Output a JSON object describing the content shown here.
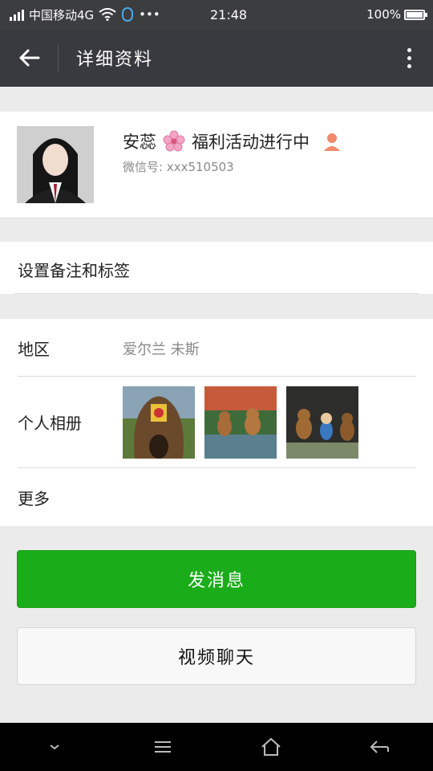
{
  "status_bar": {
    "carrier": "中国移动4G",
    "time": "21:48",
    "battery": "100%"
  },
  "app_bar": {
    "title": "详细资料"
  },
  "profile": {
    "name": "安蕊",
    "name_suffix": "福利活动进行中",
    "wechat_id": "微信号: xxx510503"
  },
  "remark": {
    "label": "设置备注和标签"
  },
  "info": {
    "region_label": "地区",
    "region_value": "爱尔兰  未斯",
    "album_label": "个人相册",
    "more_label": "更多"
  },
  "actions": {
    "send_message": "发消息",
    "video_chat": "视频聊天"
  },
  "colors": {
    "accent_green": "#1aad19",
    "header_dark": "#393a3f"
  }
}
